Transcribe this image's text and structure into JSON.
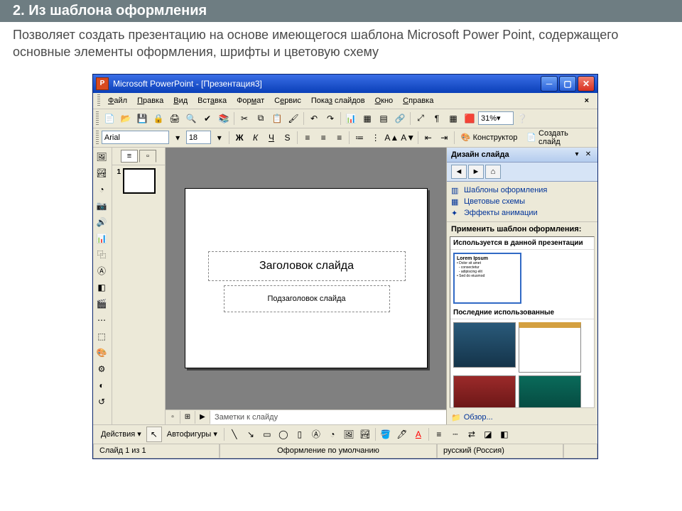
{
  "outer": {
    "title": "2. Из шаблона оформления",
    "desc": "Позволяет создать презентацию на основе имеющегося шаблона Microsoft Power Point, содержащего основные элементы оформления, шрифты и цветовую схему"
  },
  "titlebar": {
    "text": "Microsoft PowerPoint - [Презентация3]"
  },
  "menu": {
    "file": "Файл",
    "edit": "Правка",
    "view": "Вид",
    "insert": "Вставка",
    "format": "Формат",
    "tools": "Сервис",
    "slideshow": "Показ слайдов",
    "window": "Окно",
    "help": "Справка"
  },
  "toolbar2": {
    "font": "Arial",
    "size": "18",
    "bold": "Ж",
    "italic": "К",
    "underline": "Ч",
    "shadow": "S",
    "designer": "Конструктор",
    "newslide": "Создать слайд"
  },
  "zoom": "31%",
  "slide": {
    "number": "1",
    "title": "Заголовок слайда",
    "subtitle": "Подзаголовок слайда"
  },
  "notes": "Заметки к слайду",
  "taskpane": {
    "title": "Дизайн слайда",
    "link1": "Шаблоны оформления",
    "link2": "Цветовые схемы",
    "link3": "Эффекты анимации",
    "apply": "Применить шаблон оформления:",
    "group1": "Используется в данной презентации",
    "group2": "Последние использованные",
    "browse": "Обзор..."
  },
  "drawbar": {
    "actions": "Действия",
    "autoshapes": "Автофигуры"
  },
  "status": {
    "slide": "Слайд 1 из 1",
    "design": "Оформление по умолчанию",
    "lang": "русский (Россия)"
  }
}
